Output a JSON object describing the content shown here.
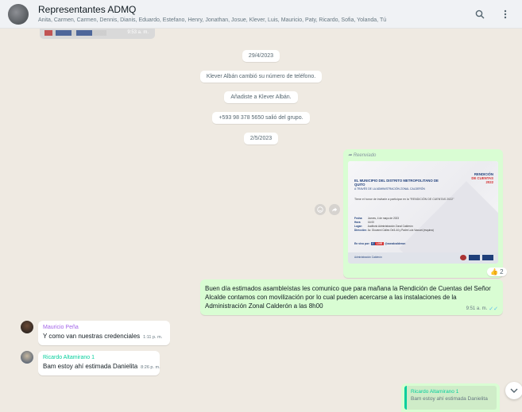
{
  "header": {
    "group_name": "Representantes ADMQ",
    "members": "Anita, Carmen, Carmen, Dennis, Dianis, Eduardo, Estefano, Henry, Jonathan, Josue, Klever, Luis, Mauricio, Paty, Ricardo, Sofia, Yolanda, Tú",
    "search_icon": "search-icon",
    "menu_icon": "kebab-menu-icon"
  },
  "clipped_image": {
    "time": "9:53 a. m."
  },
  "system_messages": [
    "29/4/2023",
    "Klever Albán cambió su número de teléfono.",
    "Añadiste a Klever Albán.",
    "+593 98 378 5650 salió del grupo.",
    "2/5/2023"
  ],
  "forwarded": {
    "label": "Reenviado",
    "poster": {
      "title_line1": "EL MUNICIPIO DEL DISTRITO METROPOLITANO DE QUITO",
      "title_line2": "A TRAVÉS DE LA ADMINISTRACIÓN ZONAL CALDERÓN",
      "brand_line1": "RENDICIÓN",
      "brand_line2": "DE CUENTAS",
      "brand_line3": "2022",
      "invite": "Tiene el honor de invitarle a participar en la \"RENDICIÓN DE CUENTAS 2022\"",
      "details": [
        {
          "k": "Fecha:",
          "v": "Jueves, 4 de mayo de 2023"
        },
        {
          "k": "Hora:",
          "v": "16:00"
        },
        {
          "k": "Lugar:",
          "v": "Auditorio Administración Zonal Calderón"
        },
        {
          "k": "Dirección:",
          "v": "Av. Giovanni Calles Oe3-44 y Padre Luis Vaccari (esquina)"
        }
      ],
      "social_prefix": "En vivo por:",
      "social_fb": "f",
      "social_live": "LIVE",
      "social_handle": "@zonalcalderon",
      "footer_left": "Administración Calderón"
    },
    "reaction": "👍 2"
  },
  "outgoing_message": {
    "text": "Buen día estimados asambleístas les comunico que para mañana la Rendición de Cuentas del Señor Alcalde contamos con movilización por lo cual  pueden acercarse a las instalaciones de la Administración Zonal Calderón a las 8h00",
    "time": "9:51 a. m.",
    "ticks": "✓✓"
  },
  "incoming": [
    {
      "sender": "Mauricio Peña",
      "text": "Y como van nuestras credenciales",
      "time": "1:11 p. m.",
      "sender_color": "#a365e8"
    },
    {
      "sender": "Ricardo Altamirano 1",
      "text": "Bam estoy ahí estimada Danielita",
      "time": "8:26 p. m.",
      "sender_color": "#06cf9c"
    }
  ],
  "reply_preview": {
    "quoted_sender": "Ricardo Altamirano 1",
    "quoted_text": "Bam estoy ahí estimada Danielita"
  },
  "colors": {
    "outgoing_bubble": "#d9fdd3",
    "chat_background": "#efeae2",
    "read_ticks": "#53bdeb"
  }
}
